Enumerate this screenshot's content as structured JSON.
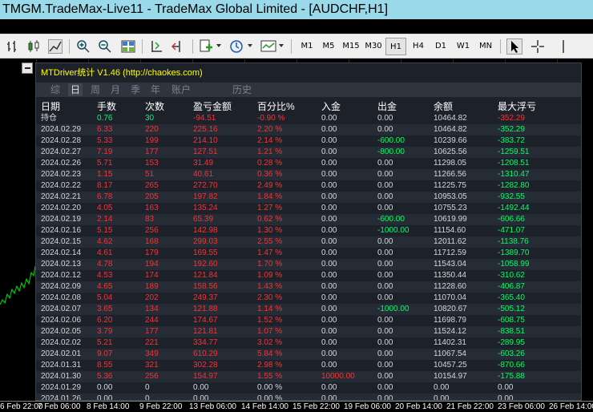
{
  "window": {
    "title": "TMGM.TradeMax-Live11 - TradeMax Global Limited - [AUDCHF,H1]"
  },
  "toolbar": {
    "timeframes": [
      "M1",
      "M5",
      "M15",
      "M30",
      "H1",
      "H4",
      "D1",
      "W1",
      "MN"
    ],
    "active_timeframe": "H1"
  },
  "panel": {
    "title": "MTDriver统计 V1.46  (http://chaokes.com)",
    "tabs": [
      "综",
      "日",
      "周",
      "月",
      "季",
      "年",
      "账户",
      "历史"
    ],
    "active_tab": "日",
    "headers": [
      "日期",
      "手数",
      "次数",
      "盈亏金额",
      "百分比%",
      "入金",
      "出金",
      "余额",
      "最大浮亏"
    ],
    "rows": [
      [
        "持仓",
        "0.76",
        "30",
        "-94.51",
        "-0.90 %",
        "0.00",
        "0.00",
        "10464.82",
        "-352.29"
      ],
      [
        "2024.02.29",
        "6.33",
        "220",
        "225.16",
        "2.20 %",
        "0.00",
        "0.00",
        "10464.82",
        "-352.29"
      ],
      [
        "2024.02.28",
        "5.33",
        "199",
        "214.10",
        "2.14 %",
        "0.00",
        "-600.00",
        "10239.66",
        "-383.72"
      ],
      [
        "2024.02.27",
        "7.19",
        "177",
        "127.51",
        "1.21 %",
        "0.00",
        "-800.00",
        "10625.56",
        "-1259.51"
      ],
      [
        "2024.02.26",
        "5.71",
        "153",
        "31.49",
        "0.28 %",
        "0.00",
        "0.00",
        "11298.05",
        "-1208.51"
      ],
      [
        "2024.02.23",
        "1.15",
        "51",
        "40.61",
        "0.36 %",
        "0.00",
        "0.00",
        "11266.56",
        "-1310.47"
      ],
      [
        "2024.02.22",
        "8.17",
        "265",
        "272.70",
        "2.49 %",
        "0.00",
        "0.00",
        "11225.75",
        "-1282.80"
      ],
      [
        "2024.02.21",
        "6.78",
        "205",
        "197.82",
        "1.84 %",
        "0.00",
        "0.00",
        "10953.05",
        "-932.55"
      ],
      [
        "2024.02.20",
        "4.05",
        "163",
        "135.24",
        "1.27 %",
        "0.00",
        "0.00",
        "10755.23",
        "-1492.44"
      ],
      [
        "2024.02.19",
        "2.14",
        "83",
        "65.39",
        "0.62 %",
        "0.00",
        "-600.00",
        "10619.99",
        "-606.66"
      ],
      [
        "2024.02.16",
        "5.15",
        "256",
        "142.98",
        "1.30 %",
        "0.00",
        "-1000.00",
        "11154.60",
        "-471.07"
      ],
      [
        "2024.02.15",
        "4.62",
        "168",
        "299.03",
        "2.55 %",
        "0.00",
        "0.00",
        "12011.62",
        "-1138.76"
      ],
      [
        "2024.02.14",
        "4.61",
        "179",
        "169.55",
        "1.47 %",
        "0.00",
        "0.00",
        "11712.59",
        "-1389.70"
      ],
      [
        "2024.02.13",
        "4.78",
        "194",
        "192.60",
        "1.70 %",
        "0.00",
        "0.00",
        "11543.04",
        "-1058.99"
      ],
      [
        "2024.02.12",
        "4.53",
        "174",
        "121.84",
        "1.09 %",
        "0.00",
        "0.00",
        "11350.44",
        "-310.62"
      ],
      [
        "2024.02.09",
        "4.65",
        "189",
        "158.56",
        "1.43 %",
        "0.00",
        "0.00",
        "11228.60",
        "-406.87"
      ],
      [
        "2024.02.08",
        "5.04",
        "202",
        "249.37",
        "2.30 %",
        "0.00",
        "0.00",
        "11070.04",
        "-365.40"
      ],
      [
        "2024.02.07",
        "3.65",
        "134",
        "121.88",
        "1.14 %",
        "0.00",
        "-1000.00",
        "10820.67",
        "-505.12"
      ],
      [
        "2024.02.06",
        "6.20",
        "244",
        "174.67",
        "1.52 %",
        "0.00",
        "0.00",
        "11698.79",
        "-608.75"
      ],
      [
        "2024.02.05",
        "3.79",
        "177",
        "121.81",
        "1.07 %",
        "0.00",
        "0.00",
        "11524.12",
        "-838.51"
      ],
      [
        "2024.02.02",
        "5.21",
        "221",
        "334.77",
        "3.02 %",
        "0.00",
        "0.00",
        "11402.31",
        "-289.95"
      ],
      [
        "2024.02.01",
        "9.07",
        "349",
        "610.29",
        "5.84 %",
        "0.00",
        "0.00",
        "11067.54",
        "-603.26"
      ],
      [
        "2024.01.31",
        "8.55",
        "321",
        "302.28",
        "2.98 %",
        "0.00",
        "0.00",
        "10457.25",
        "-870.66"
      ],
      [
        "2024.01.30",
        "5.36",
        "256",
        "154.97",
        "1.55 %",
        "10000.00",
        "0.00",
        "10154.97",
        "-175.88"
      ],
      [
        "2024.01.29",
        "0.00",
        "0",
        "0.00",
        "0.00 %",
        "0.00",
        "0.00",
        "0.00",
        "0.00"
      ],
      [
        "2024.01.26",
        "0.00",
        "0",
        "0.00",
        "0.00 %",
        "0.00",
        "0.00",
        "0.00",
        "0.00"
      ]
    ]
  },
  "time_axis": {
    "labels": [
      "6 Feb 22:00",
      "7 Feb 06:00",
      "8 Feb 14:00",
      "9 Feb 22:00",
      "13 Feb 06:00",
      "14 Feb 14:00",
      "15 Feb 22:00",
      "19 Feb 06:00",
      "20 Feb 14:00",
      "21 Feb 22:00",
      "23 Feb 06:00",
      "26 Feb 14:00"
    ]
  },
  "colors": {
    "title_bg": "#99d9ea",
    "panel_bg": "#1d222a",
    "panel_title": "#ffff00",
    "positive": "#00ff66",
    "negative": "#ff3030",
    "neutral": "#d6d6d6",
    "price_line": "#00dd00"
  }
}
